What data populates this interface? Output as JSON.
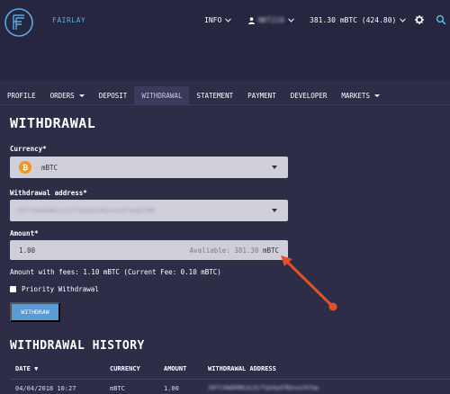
{
  "header": {
    "brand": "FAIRLAY",
    "info_label": "INFO",
    "user_label": "NKT210",
    "balance_label": "381.30 mBTC (424.80)"
  },
  "tabs": [
    {
      "label": "PROFILE"
    },
    {
      "label": "ORDERS"
    },
    {
      "label": "DEPOSIT"
    },
    {
      "label": "WITHDRAWAL"
    },
    {
      "label": "STATEMENT"
    },
    {
      "label": "PAYMENT"
    },
    {
      "label": "DEVELOPER"
    },
    {
      "label": "MARKETS"
    }
  ],
  "withdrawal": {
    "title": "WITHDRAWAL",
    "currency_label": "Currency*",
    "currency_icon": "₿",
    "currency_value": "mBTC",
    "address_label": "Withdrawal address*",
    "address_value": "1KFfJ4m8hM6Lbj2LfTpG4y47N2ouo7bfaw0ZTW8",
    "amount_label": "Amount*",
    "amount_value": "1.00",
    "available_prefix": "Avaliable: 381.30",
    "available_unit": "mBTC",
    "fees_text": "Amount with fees: 1.10 mBTC (Current Fee: 0.10 mBTC)",
    "priority_label": "Priority Withdrawal",
    "button_label": "WITHDRAW"
  },
  "history": {
    "title": "WITHDRAWAL HISTORY",
    "columns": [
      "DATE ▼",
      "CURRENCY",
      "AMOUNT",
      "WITHDRAWAL ADDRESS"
    ],
    "rows": [
      {
        "date": "04/04/2018 10:27",
        "currency": "mBTC",
        "amount": "1.00",
        "address": "1KFfJ4m8hM6Lbj2LfTpG4y47N2ouo7bfaw"
      }
    ]
  },
  "colors": {
    "background": "#2d2d48",
    "accent": "#58a9e6",
    "button": "#5b9bd5",
    "annotation_arrow": "#e0512b"
  }
}
